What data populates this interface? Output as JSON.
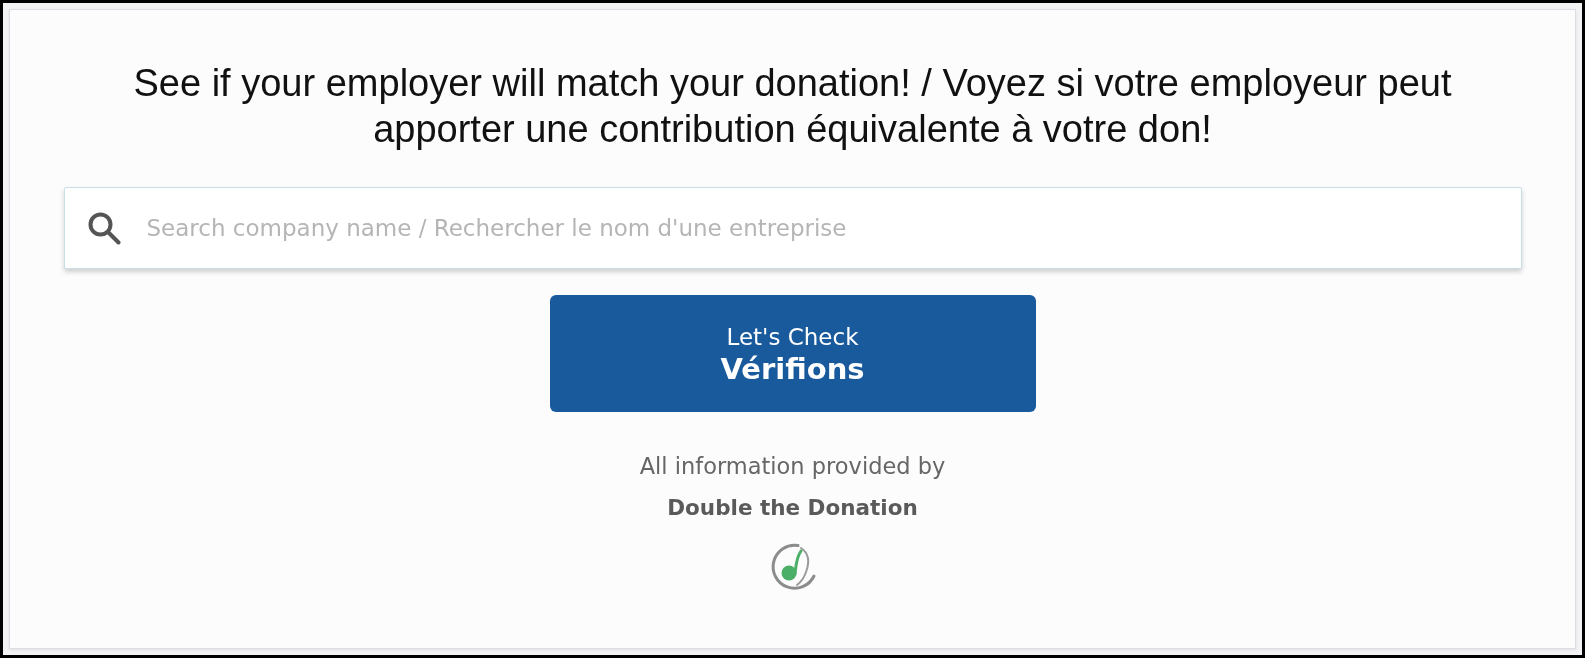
{
  "heading": "See if your employer will match your donation! / Voyez si votre employeur peut apporter une contribution équivalente à votre don!",
  "search": {
    "placeholder": "Search company name / Rechercher le nom d'une entreprise"
  },
  "check_button": {
    "label": "Let's Check",
    "sublabel": "Vérifions"
  },
  "attribution": {
    "text": "All information provided by",
    "provider": "Double the Donation"
  }
}
